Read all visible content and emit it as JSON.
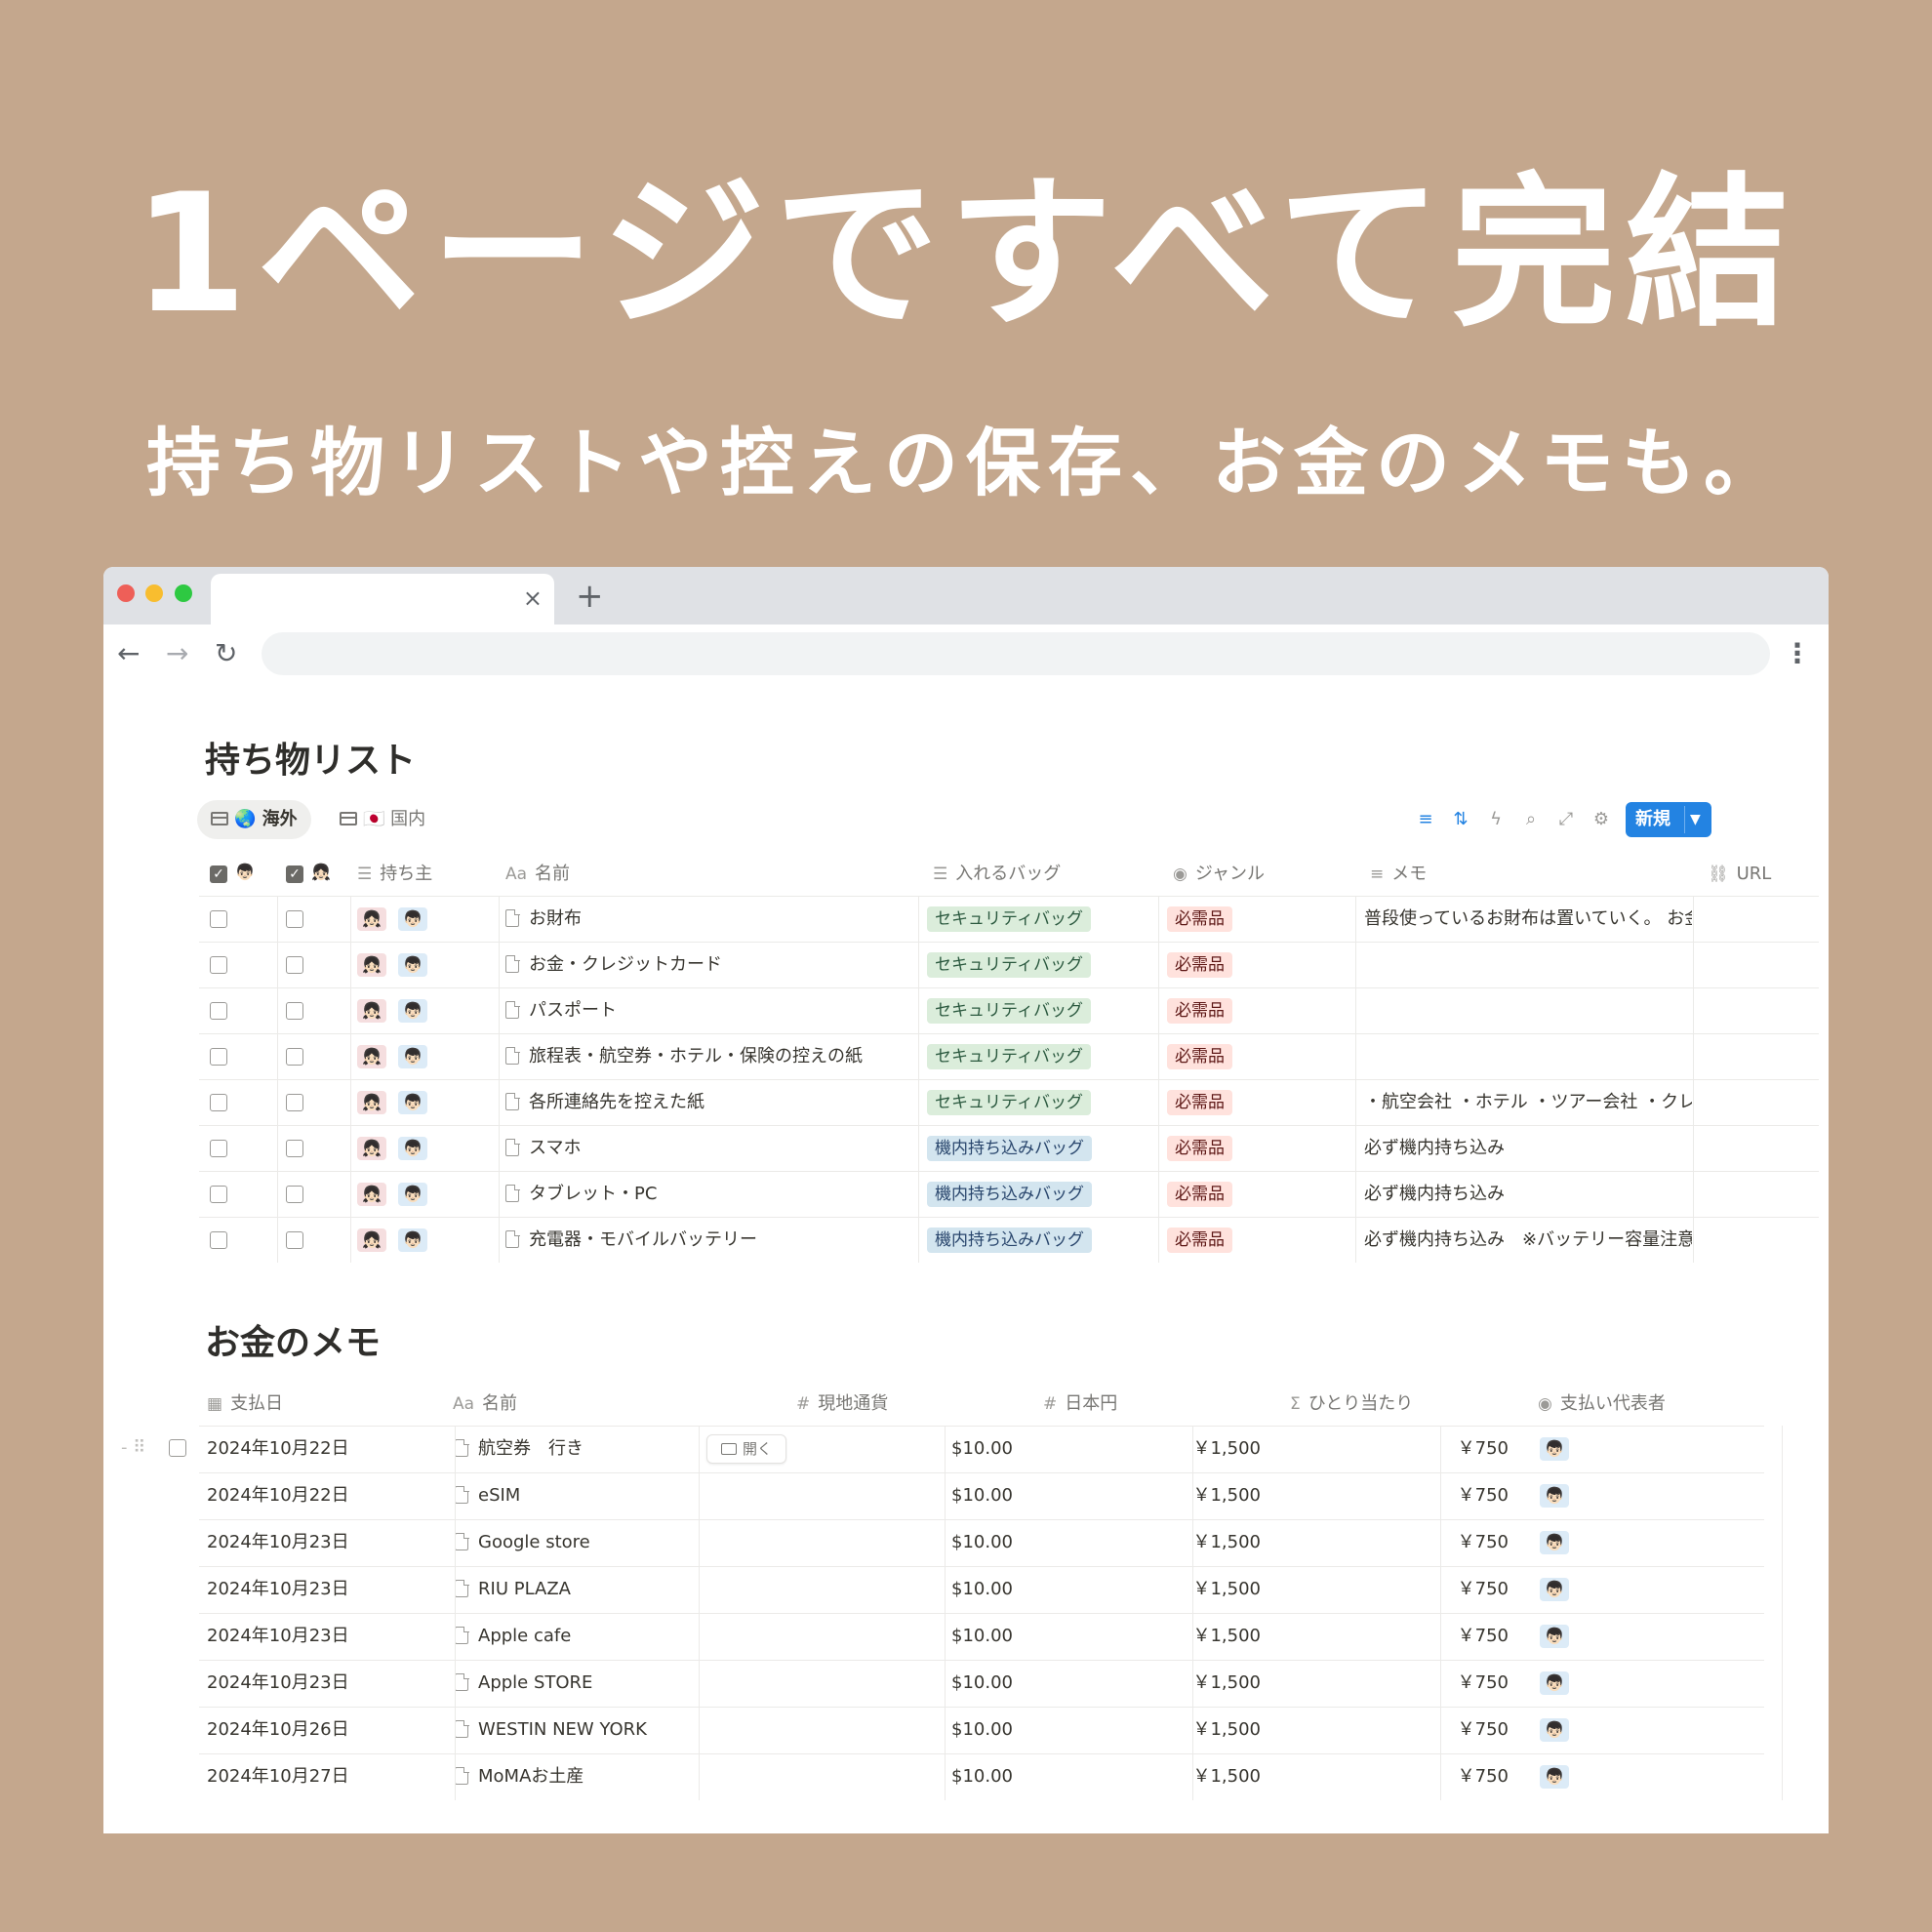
{
  "headline": "1ページですべて完結",
  "subline": "持ち物リストや控えの保存、お金のメモも。",
  "browser": {
    "tab_close": "×",
    "new_tab": "+",
    "back": "←",
    "forward": "→",
    "reload": "↻",
    "menu": "⋮"
  },
  "packing": {
    "title": "持ち物リスト",
    "views": [
      {
        "label": "🌏 海外",
        "active": true
      },
      {
        "label": "🇯🇵 国内",
        "active": false
      }
    ],
    "new_label": "新規",
    "columns": {
      "owner": "持ち主",
      "name": "名前",
      "bag": "入れるバッグ",
      "genre": "ジャンル",
      "memo": "メモ",
      "url": "URL"
    },
    "rows": [
      {
        "name": "お財布",
        "bag": "セキュリティバッグ",
        "bag_color": "green",
        "genre": "必需品",
        "memo": "普段使っているお財布は置いていく。 お金"
      },
      {
        "name": "お金・クレジットカード",
        "bag": "セキュリティバッグ",
        "bag_color": "green",
        "genre": "必需品",
        "memo": ""
      },
      {
        "name": "パスポート",
        "bag": "セキュリティバッグ",
        "bag_color": "green",
        "genre": "必需品",
        "memo": ""
      },
      {
        "name": "旅程表・航空券・ホテル・保険の控えの紙",
        "bag": "セキュリティバッグ",
        "bag_color": "green",
        "genre": "必需品",
        "memo": ""
      },
      {
        "name": "各所連絡先を控えた紙",
        "bag": "セキュリティバッグ",
        "bag_color": "green",
        "genre": "必需品",
        "memo": "・航空会社 ・ホテル ・ツアー会社 ・クレ"
      },
      {
        "name": "スマホ",
        "bag": "機内持ち込みバッグ",
        "bag_color": "blue",
        "genre": "必需品",
        "memo": "必ず機内持ち込み"
      },
      {
        "name": "タブレット・PC",
        "bag": "機内持ち込みバッグ",
        "bag_color": "blue",
        "genre": "必需品",
        "memo": "必ず機内持ち込み"
      },
      {
        "name": "充電器・モバイルバッテリー",
        "bag": "機内持ち込みバッグ",
        "bag_color": "blue",
        "genre": "必需品",
        "memo": "必ず機内持ち込み　※バッテリー容量注意"
      }
    ]
  },
  "money": {
    "title": "お金のメモ",
    "columns": {
      "date": "支払日",
      "name": "名前",
      "local": "現地通貨",
      "jpy": "日本円",
      "per": "ひとり当たり",
      "payer": "支払い代表者"
    },
    "open_label": "開く",
    "rows": [
      {
        "date": "2024年10月22日",
        "name": "航空券　行き",
        "local": "$10.00",
        "jpy": "￥1,500",
        "per": "￥750"
      },
      {
        "date": "2024年10月22日",
        "name": "eSIM",
        "local": "$10.00",
        "jpy": "￥1,500",
        "per": "￥750"
      },
      {
        "date": "2024年10月23日",
        "name": "Google store",
        "local": "$10.00",
        "jpy": "￥1,500",
        "per": "￥750"
      },
      {
        "date": "2024年10月23日",
        "name": "RIU PLAZA",
        "local": "$10.00",
        "jpy": "￥1,500",
        "per": "￥750"
      },
      {
        "date": "2024年10月23日",
        "name": "Apple cafe",
        "local": "$10.00",
        "jpy": "￥1,500",
        "per": "￥750"
      },
      {
        "date": "2024年10月23日",
        "name": "Apple STORE",
        "local": "$10.00",
        "jpy": "￥1,500",
        "per": "￥750"
      },
      {
        "date": "2024年10月26日",
        "name": "WESTIN NEW YORK",
        "local": "$10.00",
        "jpy": "￥1,500",
        "per": "￥750"
      },
      {
        "date": "2024年10月27日",
        "name": "MoMAお土産",
        "local": "$10.00",
        "jpy": "￥1,500",
        "per": "￥750"
      }
    ]
  },
  "avatars": {
    "female": "👧🏻",
    "male": "👦🏻"
  },
  "colors": {
    "background": "#c4a78d",
    "accent": "#2383e2"
  }
}
